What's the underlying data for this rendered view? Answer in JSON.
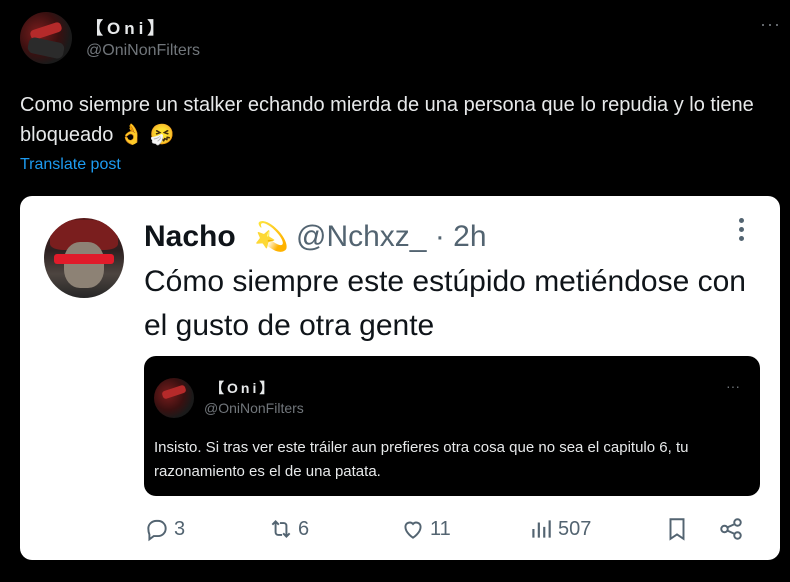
{
  "post": {
    "author_name": "【Oni】",
    "author_handle": "@OniNonFilters",
    "more_label": "···",
    "text": "Como siempre un stalker echando mierda de una persona que lo repudia y lo tiene bloqueado",
    "emojis": [
      "👌",
      "🤧"
    ],
    "translate_label": "Translate post"
  },
  "embedded": {
    "author_name": "Nacho",
    "badge_emoji": "💫",
    "author_handle": "@Nchxz_ · 2h",
    "text": "Cómo siempre este estúpido metiéndose con el gusto de otra gente",
    "quote": {
      "author_name": "【Oni】",
      "author_handle": "@OniNonFilters",
      "more_label": "···",
      "text": "Insisto. Si tras ver este tráiler aun prefieres otra cosa que no sea el capitulo 6, tu razonamiento es el de una patata."
    },
    "actions": {
      "replies": "3",
      "reposts": "6",
      "likes": "11",
      "views": "507"
    }
  }
}
